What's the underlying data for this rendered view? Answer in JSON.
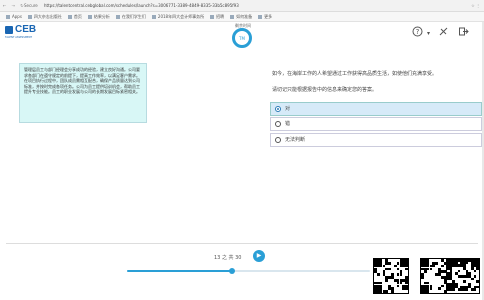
{
  "browser": {
    "security": "Secure",
    "url": "https://talentcentral.cebglobal.com/schedules/launch?s=3006771-3389-4849-8335-33b5c895f93",
    "nav_icons": "← → ↻",
    "right_icons": "☆ ⋮"
  },
  "bookmarks": [
    {
      "label": "Apps"
    },
    {
      "label": "四大杂志出版社"
    },
    {
      "label": "首页"
    },
    {
      "label": "结果分析"
    },
    {
      "label": "在我们学生们"
    },
    {
      "label": "2018年四大会计师事务所"
    },
    {
      "label": "招聘"
    },
    {
      "label": "如何准备"
    },
    {
      "label": "更多"
    }
  ],
  "app": {
    "logo_text": "CEB",
    "logo_subtext": "TALENT ASSESSMENT",
    "timer_label": "剩余时间",
    "timer_value": "TM",
    "help_icon": "help-icon",
    "accessibility_icon": "accessibility-icon",
    "exit_icon": "exit-icon"
  },
  "passage": {
    "text": "管理层员工与部门经理会分享成功的经验，建立良好沟通。公司要求各部门在遵守规定的前提下，提高工作效率，以满足客户需求。在项目执行过程中，团队成员需相互配合，确保产品质量达到公司标准，并按时完成各项任务。公司为员工提供培训机会，帮助员工提升专业技能。员工的职业发展与公司的长期发展目标紧密相关。"
  },
  "question": {
    "text": "如今，在海岸工作的人希望通过工作获得高品质生活，如使他们充满享受。",
    "instruction": "请切记只能根据报告中的信息来确定您的答案。"
  },
  "options": [
    {
      "label": "对",
      "selected": true
    },
    {
      "label": "错",
      "selected": false
    },
    {
      "label": "无法判断",
      "selected": false
    }
  ],
  "progress": {
    "text": "13 之 共 30",
    "current": 13,
    "total": 30,
    "fraction": 0.433
  },
  "colors": {
    "accent": "#2a9fd6",
    "brand": "#1a66b3",
    "passage_bg": "#d8f7f6",
    "selected_bg": "#d6eaf8"
  }
}
